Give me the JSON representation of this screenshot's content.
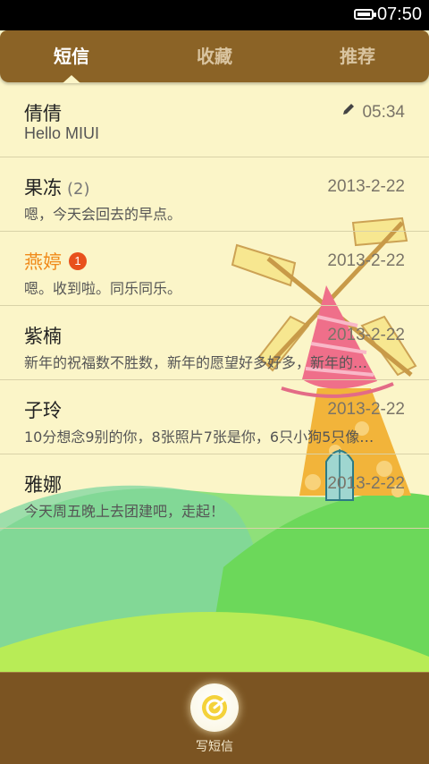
{
  "status_bar": {
    "time": "07:50"
  },
  "tabs": [
    {
      "label": "短信",
      "active": true
    },
    {
      "label": "收藏",
      "active": false
    },
    {
      "label": "推荐",
      "active": false
    }
  ],
  "conversations": [
    {
      "name": "倩倩",
      "count": "",
      "badge": "",
      "time": "05:34",
      "preview": "Hello MIUI",
      "draft": true,
      "unread": false
    },
    {
      "name": "果冻",
      "count": "(2)",
      "badge": "",
      "time": "2013-2-22",
      "preview": "嗯，今天会回去的早点。",
      "draft": false,
      "unread": false
    },
    {
      "name": "燕婷",
      "count": "",
      "badge": "1",
      "time": "2013-2-22",
      "preview": "嗯。收到啦。同乐同乐。",
      "draft": false,
      "unread": true
    },
    {
      "name": "紫楠",
      "count": "",
      "badge": "",
      "time": "2013-2-22",
      "preview": "新年的祝福数不胜数，新年的愿望好多好多，新年的…",
      "draft": false,
      "unread": false
    },
    {
      "name": "子玲",
      "count": "",
      "badge": "",
      "time": "2013-2-22",
      "preview": "10分想念9别的你，8张照片7张是你，6只小狗5只像…",
      "draft": false,
      "unread": false
    },
    {
      "name": "雅娜",
      "count": "",
      "badge": "",
      "time": "2013-2-22",
      "preview": "今天周五晚上去团建吧，走起！",
      "draft": false,
      "unread": false
    }
  ],
  "compose": {
    "label": "写短信"
  },
  "colors": {
    "tabbar": "#8b6326",
    "bottombar": "#7b5422",
    "list_bg": "#fbf5c8",
    "unread_name": "#f08a1a",
    "badge": "#e8501c"
  }
}
